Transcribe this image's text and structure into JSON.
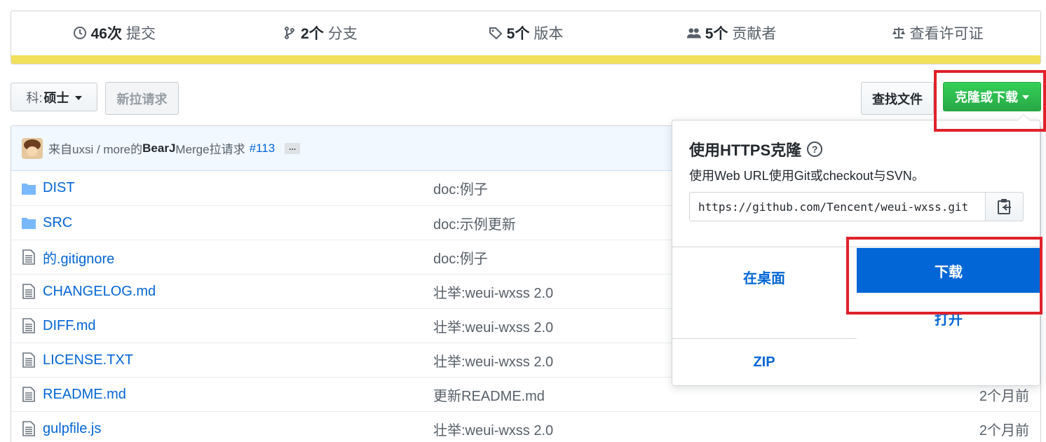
{
  "summary": {
    "commits": {
      "count": "46次",
      "label": "提交"
    },
    "branches": {
      "count": "2个",
      "label": "分支"
    },
    "releases": {
      "count": "5个",
      "label": "版本"
    },
    "contributors": {
      "count": "5个",
      "label": "贡献者"
    },
    "license": {
      "label": "查看许可证"
    },
    "language_color": "#f1e05a"
  },
  "toolbar": {
    "branch_prefix": "科:",
    "branch_value": "硕士",
    "new_pr_label": "新拉请求",
    "find_file_label": "查找文件",
    "clone_label": "克隆或下载"
  },
  "commit": {
    "text": "来自uxsi / more的",
    "author": "BearJ",
    "message": " Merge拉请求",
    "pr_link": "#113",
    "ellipsis": "..."
  },
  "files": [
    {
      "name": "DIST",
      "message": "doc:例子",
      "age": "",
      "type": "folder-icon"
    },
    {
      "name": "SRC",
      "message": "doc:示例更新",
      "age": "",
      "type": "folder-icon"
    },
    {
      "name": "的.gitignore",
      "message": "doc:例子",
      "age": "",
      "type": "file-icon"
    },
    {
      "name": "CHANGELOG.md",
      "message": "壮举:weui-wxss 2.0",
      "age": "",
      "type": "file-icon"
    },
    {
      "name": "DIFF.md",
      "message": "壮举:weui-wxss 2.0",
      "age": "",
      "type": "file-icon"
    },
    {
      "name": "LICENSE.TXT",
      "message": "壮举:weui-wxss 2.0",
      "age": "",
      "type": "file-icon"
    },
    {
      "name": "README.md",
      "message": "更新README.md",
      "age": "2个月前",
      "type": "file-icon"
    },
    {
      "name": "gulpfile.js",
      "message": "壮举:weui-wxss 2.0",
      "age": "2个月前",
      "type": "file-icon"
    }
  ],
  "clone_popover": {
    "title": "使用HTTPS克隆",
    "description": "使用Web URL使用Git或checkout与SVN。",
    "url": "https://github.com/Tencent/weui-wxss.git",
    "open_desktop_label": "在桌面",
    "download_label": "下载",
    "open_label": "打开",
    "zip_label": "ZIP"
  },
  "colors": {
    "accent": "#0366d6",
    "clone_green": "#28a745",
    "highlight_red": "#e0212b"
  }
}
